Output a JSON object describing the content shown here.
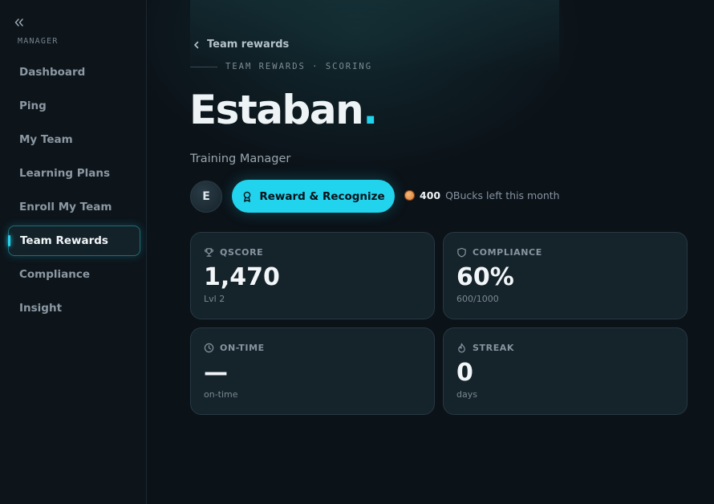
{
  "sidebar": {
    "heading": "MANAGER",
    "items": [
      {
        "label": "Dashboard"
      },
      {
        "label": "Ping"
      },
      {
        "label": "My Team"
      },
      {
        "label": "Learning Plans"
      },
      {
        "label": "Enroll My Team"
      },
      {
        "label": "Team Rewards",
        "active": true
      },
      {
        "label": "Compliance"
      },
      {
        "label": "Insight"
      }
    ]
  },
  "header": {
    "back_label": "Team rewards",
    "eyebrow": "TEAM REWARDS · SCORING",
    "name": "Estaban",
    "name_dot": ".",
    "role": "Training Manager"
  },
  "actions": {
    "avatar_initial": "E",
    "reward_button": "Reward & Recognize",
    "qbucks_amount": "400",
    "qbucks_text": "QBucks left this month"
  },
  "stats": [
    {
      "label": "QSCORE",
      "value": "1,470",
      "sub": "Lvl 2",
      "icon": "trophy-icon"
    },
    {
      "label": "COMPLIANCE",
      "value": "60%",
      "sub": "600/1000",
      "icon": "shield-icon"
    },
    {
      "label": "ON-TIME",
      "value": "—",
      "sub": "on-time",
      "icon": "clock-icon"
    },
    {
      "label": "STREAK",
      "value": "0",
      "sub": "days",
      "icon": "flame-icon"
    }
  ],
  "colors": {
    "accent": "#22d3ee",
    "background": "#0b1218",
    "card": "#15232b"
  }
}
